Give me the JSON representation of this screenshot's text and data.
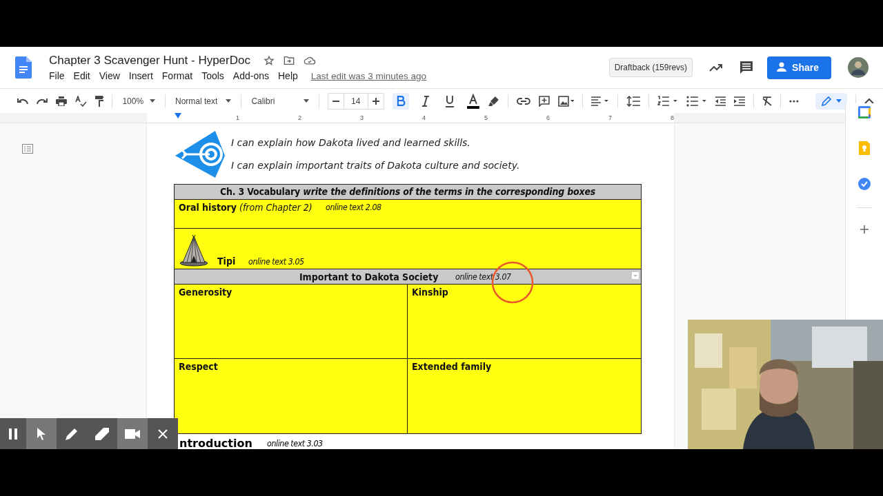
{
  "window": {
    "title": "Chapter 3 Scavenger Hunt - HyperDoc",
    "menu": [
      "File",
      "Edit",
      "View",
      "Insert",
      "Format",
      "Tools",
      "Add-ons",
      "Help"
    ],
    "last_edit": "Last edit was 3 minutes ago",
    "draftback": "Draftback (159revs)",
    "share": "Share"
  },
  "toolbar": {
    "zoom": "100%",
    "style": "Normal text",
    "font": "Calibri",
    "size": "14",
    "bold": true,
    "italic": false,
    "underline": false,
    "editing": true
  },
  "ruler": [
    "1",
    "2",
    "3",
    "4",
    "5",
    "6",
    "7",
    "8"
  ],
  "objectives": [
    "I can explain how Dakota lived and learned skills.",
    "I can explain important traits of Dakota culture and society."
  ],
  "table": {
    "heading": "Ch. 3 Vocabulary *write the definitions of the terms in the corresponding boxes*",
    "oral": {
      "term": "Oral history",
      "note": "(from Chapter 2)",
      "link": "online text 2.08"
    },
    "tipi": {
      "term": "Tipi",
      "link": "online text 3.05"
    },
    "society": {
      "title": "Important to Dakota Society",
      "link": "online text 3.07"
    },
    "cells": [
      "Generosity",
      "Kinship",
      "Respect",
      "Extended family"
    ]
  },
  "next": {
    "title": "ntroduction",
    "link": "online text 3.03"
  },
  "recorder": [
    {
      "kind": "pause",
      "selected": false
    },
    {
      "kind": "pointer",
      "selected": true
    },
    {
      "kind": "pen",
      "selected": false
    },
    {
      "kind": "highlighter",
      "selected": false
    },
    {
      "kind": "camera",
      "selected": true
    },
    {
      "kind": "close",
      "selected": false
    }
  ]
}
